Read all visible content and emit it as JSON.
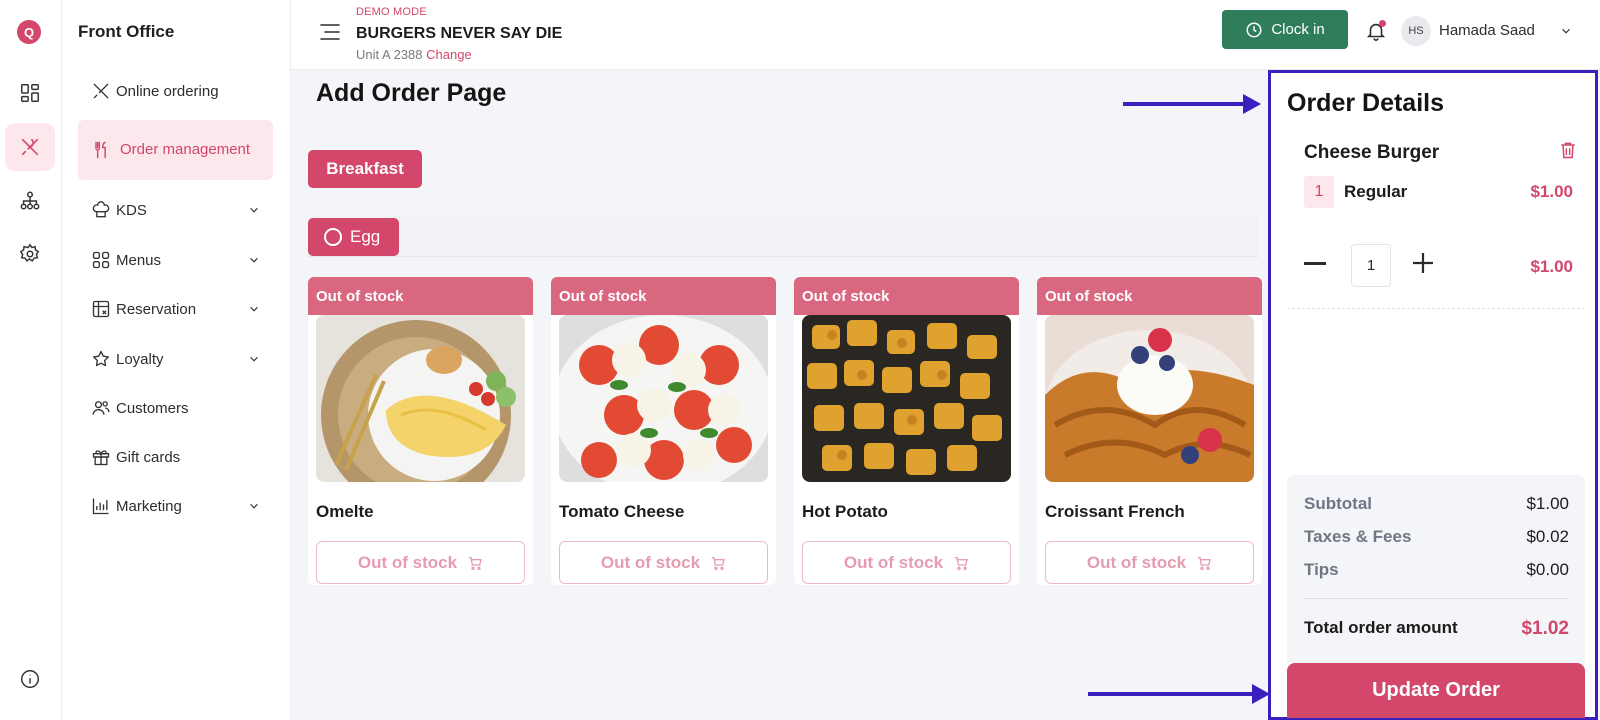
{
  "rail": {
    "logo_letter": "Q",
    "items": [
      {
        "icon": "dashboard-icon"
      },
      {
        "icon": "fork-knife-icon"
      },
      {
        "icon": "org-chart-icon"
      },
      {
        "icon": "gear-icon"
      },
      {
        "icon": "info-icon"
      }
    ]
  },
  "sidebar": {
    "title": "Front Office",
    "items": [
      {
        "label": "Online ordering",
        "icon": "fork-knife-icon"
      },
      {
        "label": "Order management",
        "icon": "utensils-icon"
      },
      {
        "label": "KDS",
        "icon": "chef-hat-icon"
      },
      {
        "label": "Menus",
        "icon": "grid-icon"
      },
      {
        "label": "Reservation",
        "icon": "calendar-icon"
      },
      {
        "label": "Loyalty",
        "icon": "star-icon"
      },
      {
        "label": "Customers",
        "icon": "users-icon"
      },
      {
        "label": "Gift cards",
        "icon": "gift-icon"
      },
      {
        "label": "Marketing",
        "icon": "bar-chart-icon"
      }
    ]
  },
  "header": {
    "demo_mode": "DEMO MODE",
    "store_name": "BURGERS NEVER SAY DIE",
    "unit": "Unit A 2388",
    "change_link": "Change",
    "clock_in": "Clock in",
    "avatar_initials": "HS",
    "user_name": "Hamada Saad"
  },
  "main": {
    "title": "Add Order Page",
    "category": "Breakfast",
    "subcategory": "Egg",
    "products": [
      {
        "badge": "Out of stock",
        "name": "Omelte",
        "button": "Out of stock",
        "image": "omelette-photo"
      },
      {
        "badge": "Out of stock",
        "name": "Tomato Cheese",
        "button": "Out of stock",
        "image": "caprese-photo"
      },
      {
        "badge": "Out of stock",
        "name": "Hot Potato",
        "button": "Out of stock",
        "image": "roasted-potato-photo"
      },
      {
        "badge": "Out of stock",
        "name": "Croissant French",
        "button": "Out of stock",
        "image": "croissant-photo"
      }
    ]
  },
  "order": {
    "title": "Order Details",
    "item_name": "Cheese Burger",
    "item_qty_badge": "1",
    "variant": "Regular",
    "variant_price": "$1.00",
    "quantity": "1",
    "line_total": "$1.00",
    "subtotal_label": "Subtotal",
    "subtotal": "$1.00",
    "taxes_label": "Taxes & Fees",
    "taxes": "$0.02",
    "tips_label": "Tips",
    "tips": "$0.00",
    "total_label": "Total order amount",
    "total": "$1.02",
    "update_button": "Update Order"
  },
  "colors": {
    "brand": "#d2476a",
    "clock_green": "#2f7d5b",
    "annotation": "#3a1fbf"
  }
}
